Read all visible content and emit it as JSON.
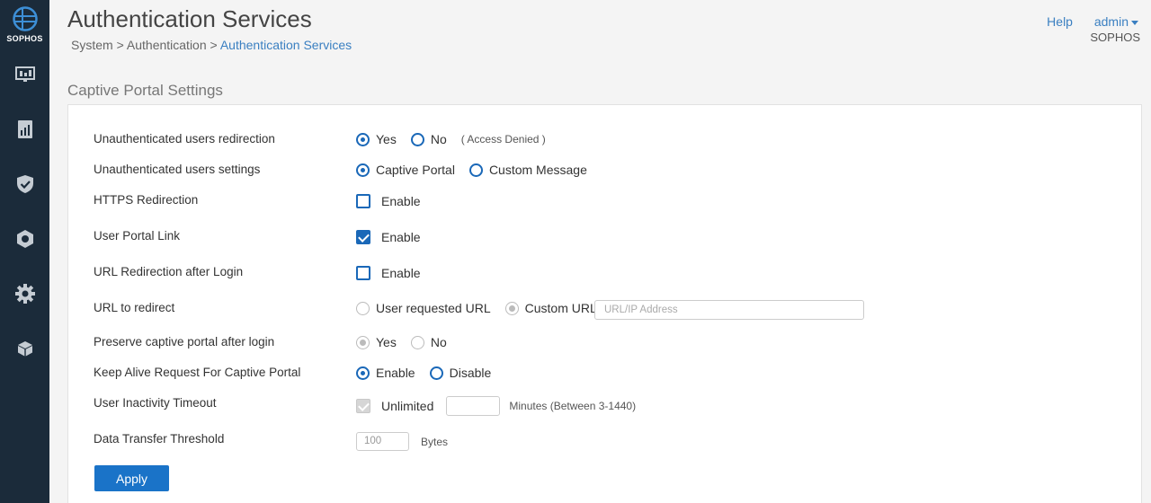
{
  "brand": {
    "logo_text": "SOPHOS"
  },
  "header": {
    "title": "Authentication Services",
    "breadcrumb": [
      "System",
      "Authentication",
      "Authentication Services"
    ],
    "breadcrumb_sep": ">",
    "help": "Help",
    "user": "admin",
    "org": "SOPHOS"
  },
  "sidebar": {
    "icons": [
      "monitor-icon",
      "report-icon",
      "shield-icon",
      "protect-icon",
      "gear-icon",
      "box-icon"
    ]
  },
  "section": {
    "title": "Captive Portal Settings"
  },
  "form": {
    "redirection": {
      "label": "Unauthenticated users redirection",
      "opt1": "Yes",
      "opt2": "No",
      "note": "( Access Denied )",
      "selected": "Yes"
    },
    "settings": {
      "label": "Unauthenticated users settings",
      "opt1": "Captive Portal",
      "opt2": "Custom Message",
      "selected": "Captive Portal"
    },
    "https": {
      "label": "HTTPS Redirection",
      "check": "Enable",
      "checked": false
    },
    "portal_link": {
      "label": "User Portal Link",
      "check": "Enable",
      "checked": true
    },
    "url_redirect_login": {
      "label": "URL Redirection after Login",
      "check": "Enable",
      "checked": false
    },
    "url_to_redirect": {
      "label": "URL to redirect",
      "opt1": "User requested URL",
      "opt2": "Custom URL",
      "selected": "Custom URL",
      "placeholder": "URL/IP Address"
    },
    "preserve": {
      "label": "Preserve captive portal after login",
      "opt1": "Yes",
      "opt2": "No",
      "selected": "Yes"
    },
    "keepalive": {
      "label": "Keep Alive Request For Captive Portal",
      "opt1": "Enable",
      "opt2": "Disable",
      "selected": "Enable"
    },
    "inactivity": {
      "label": "User Inactivity Timeout",
      "check": "Unlimited",
      "checked": true,
      "unit": "Minutes (Between 3-1440)"
    },
    "threshold": {
      "label": "Data Transfer Threshold",
      "value": "100",
      "unit": "Bytes"
    },
    "apply": "Apply"
  },
  "colors": {
    "sidebar": "#1b2b3a",
    "accent": "#1a73c8",
    "link": "#3a7fc1"
  }
}
